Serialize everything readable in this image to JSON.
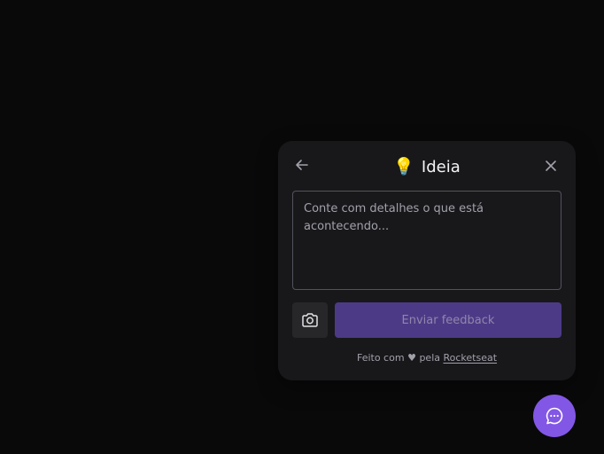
{
  "widget": {
    "title": "Ideia",
    "emoji": "💡",
    "comment_placeholder": "Conte com detalhes o que está acontecendo...",
    "submit_label": "Enviar feedback",
    "footer": {
      "prefix": "Feito com",
      "heart": "♥",
      "middle": "pela",
      "link": "Rocketseat"
    },
    "icons": {
      "back": "arrow-left-icon",
      "close": "close-icon",
      "screenshot": "camera-icon",
      "fab": "chat-bubble-icon"
    }
  },
  "colors": {
    "background": "#09090a",
    "panel": "#18181b",
    "brand": "#8257e5",
    "brand_disabled": "#4d3a86"
  }
}
